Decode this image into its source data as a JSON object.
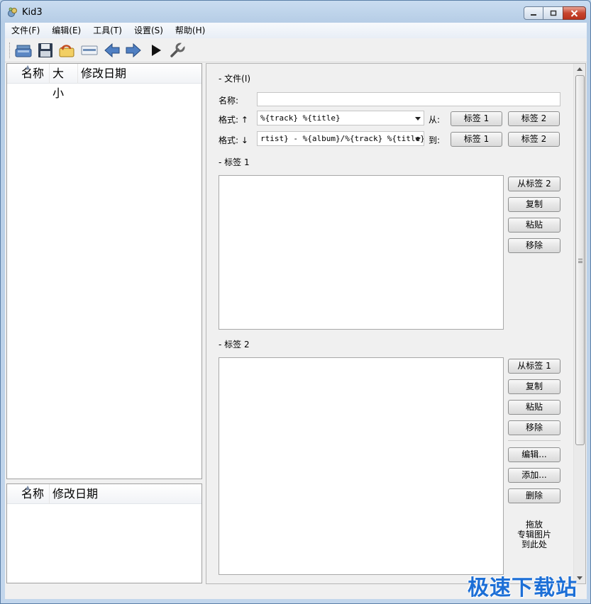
{
  "window": {
    "title": "Kid3"
  },
  "menu": {
    "items": [
      "文件(F)",
      "编辑(E)",
      "工具(T)",
      "设置(S)",
      "帮助(H)"
    ]
  },
  "toolbar": {
    "icons": [
      "open-folder-icon",
      "save-icon",
      "revert-icon",
      "properties-icon",
      "previous-icon",
      "next-icon",
      "play-icon",
      "settings-wrench-icon"
    ]
  },
  "filelist": {
    "columns": [
      "名称",
      "大小",
      "修改日期"
    ]
  },
  "dirlist": {
    "columns": [
      "名称",
      "修改日期"
    ]
  },
  "file_section": {
    "label": "- 文件(I)",
    "name_label": "名称:",
    "name_value": "",
    "format_up_label": "格式: ↑",
    "format_up_value": "%{track} %{title}",
    "from_label": "从:",
    "format_down_label": "格式: ↓",
    "format_down_value": "rtist} - %{album}/%{track} %{title}",
    "to_label": "到:",
    "tag1_button": "标签 1",
    "tag2_button": "标签 2"
  },
  "tag1_section": {
    "label": "- 标签 1",
    "from_tag_button": "从标签 2",
    "copy_button": "复制",
    "paste_button": "粘贴",
    "remove_button": "移除"
  },
  "tag2_section": {
    "label": "- 标签 2",
    "from_tag_button": "从标签 1",
    "copy_button": "复制",
    "paste_button": "粘贴",
    "remove_button": "移除",
    "edit_button": "编辑...",
    "add_button": "添加...",
    "delete_button": "删除",
    "drop_text_line1": "拖放",
    "drop_text_line2": "专辑图片",
    "drop_text_line3": "到此处"
  },
  "watermark": {
    "text": "极速下载站"
  },
  "colors": {
    "titlebar": "#b6cde6",
    "close_button": "#c7442d",
    "watermark": "#1d6fd6"
  }
}
